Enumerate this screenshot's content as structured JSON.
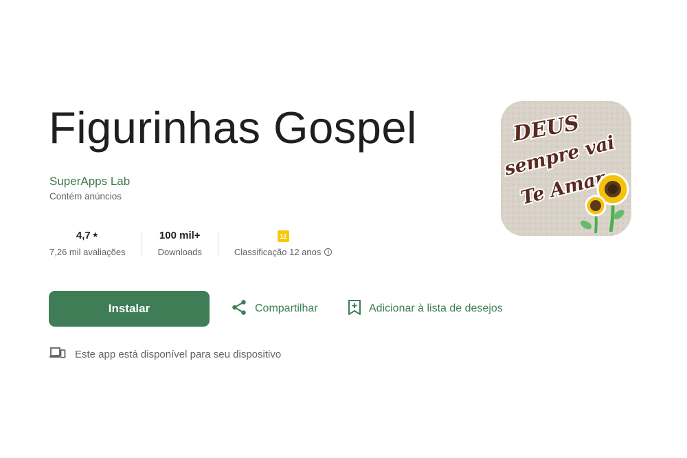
{
  "app": {
    "title": "Figurinhas Gospel",
    "developer": "SuperApps Lab",
    "ads_notice": "Contém anúncios"
  },
  "icon": {
    "name": "app-icon-sunflower",
    "text_line1": "DEUS",
    "text_line2": "sempre vai",
    "text_line3": "Te Amar"
  },
  "stats": {
    "rating": {
      "value": "4,7",
      "label": "7,26 mil avaliações"
    },
    "downloads": {
      "value": "100 mil+",
      "label": "Downloads"
    },
    "content_rating": {
      "badge": "12",
      "label": "Classificação 12 anos"
    }
  },
  "actions": {
    "install_label": "Instalar",
    "share_label": "Compartilhar",
    "wishlist_label": "Adicionar à lista de desejos"
  },
  "device_notice": "Este app está disponível para seu dispositivo",
  "colors": {
    "accent": "#3e7d56",
    "developer": "#3a7a4b",
    "badge_yellow": "#f9c80e",
    "icon_text": "#5a2a1e"
  }
}
